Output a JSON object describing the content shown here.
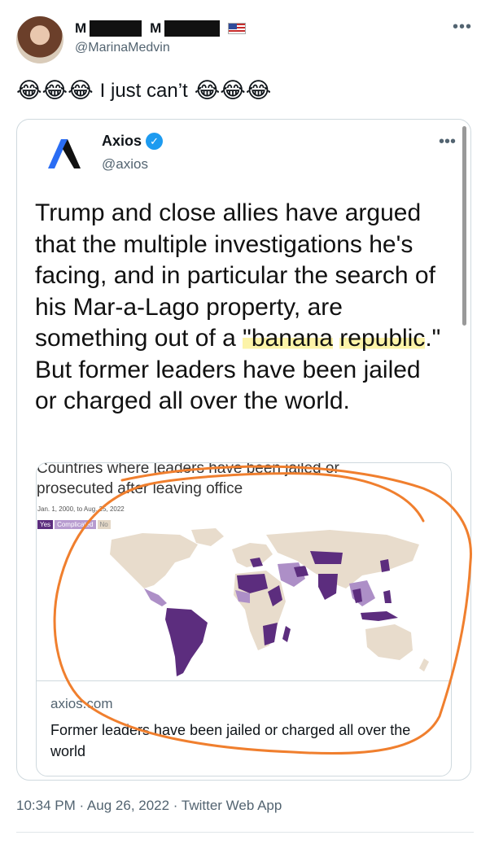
{
  "author": {
    "name_part1": "M",
    "name_part2": "M",
    "handle": "@MarinaMedvin"
  },
  "tweet": {
    "emoji_before": "😂😂😂",
    "text": "I just can’t",
    "emoji_after": "😂😂😂",
    "timestamp": "10:34 PM · Aug 26, 2022 · Twitter Web App"
  },
  "quote": {
    "name": "Axios",
    "handle": "@axios",
    "text_part1": "Trump and close allies have argued that the multiple investigations he's facing, and in particular the search of his Mar-a-Lago property, are something out of a ",
    "text_hl1": "\"banana",
    "text_hl2": "republic",
    "text_part2": ".\" But former leaders have been jailed or charged all over the world."
  },
  "card": {
    "chart_title": "Countries where leaders have been jailed or prosecuted after leaving office",
    "chart_subtitle": "Jan. 1, 2000, to Aug. 25, 2022",
    "legend": [
      {
        "label": "Yes",
        "color": "#5c2d7e"
      },
      {
        "label": "Complicated",
        "color": "#b79bcf"
      },
      {
        "label": "No",
        "color": "#e3d7c6"
      }
    ],
    "domain": "axios.com",
    "title": "Former leaders have been jailed or charged all over the world"
  },
  "colors": {
    "land": "#e8dccc",
    "yes": "#5c2d7e",
    "complicated": "#ad8fc7",
    "annotation": "#f07f2e",
    "verified": "#1d9bf0"
  }
}
